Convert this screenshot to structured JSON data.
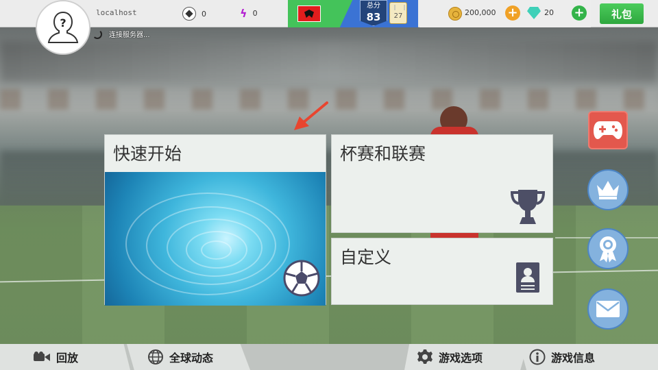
{
  "profile": {
    "username": "localhost",
    "connecting_text": "连接服务器..."
  },
  "stats": {
    "balls": "0",
    "energy": "0"
  },
  "team": {
    "country_flag": "albania-flag",
    "rating_label": "总分",
    "rating_value": "83",
    "card_value": "27"
  },
  "currency": {
    "coins": "200,000",
    "gems": "20"
  },
  "gift_label": "礼包",
  "tiles": {
    "quick_start": "快速开始",
    "cups_leagues": "杯赛和联赛",
    "custom": "自定义"
  },
  "bottom_nav": {
    "replay": "回放",
    "global_news": "全球动态",
    "game_options": "游戏选项",
    "game_info": "游戏信息"
  },
  "colors": {
    "accent_green": "#34b44a",
    "accent_orange": "#f0a126",
    "side_button_blue": "#84b2de",
    "gamepad_red": "#e3584d"
  }
}
